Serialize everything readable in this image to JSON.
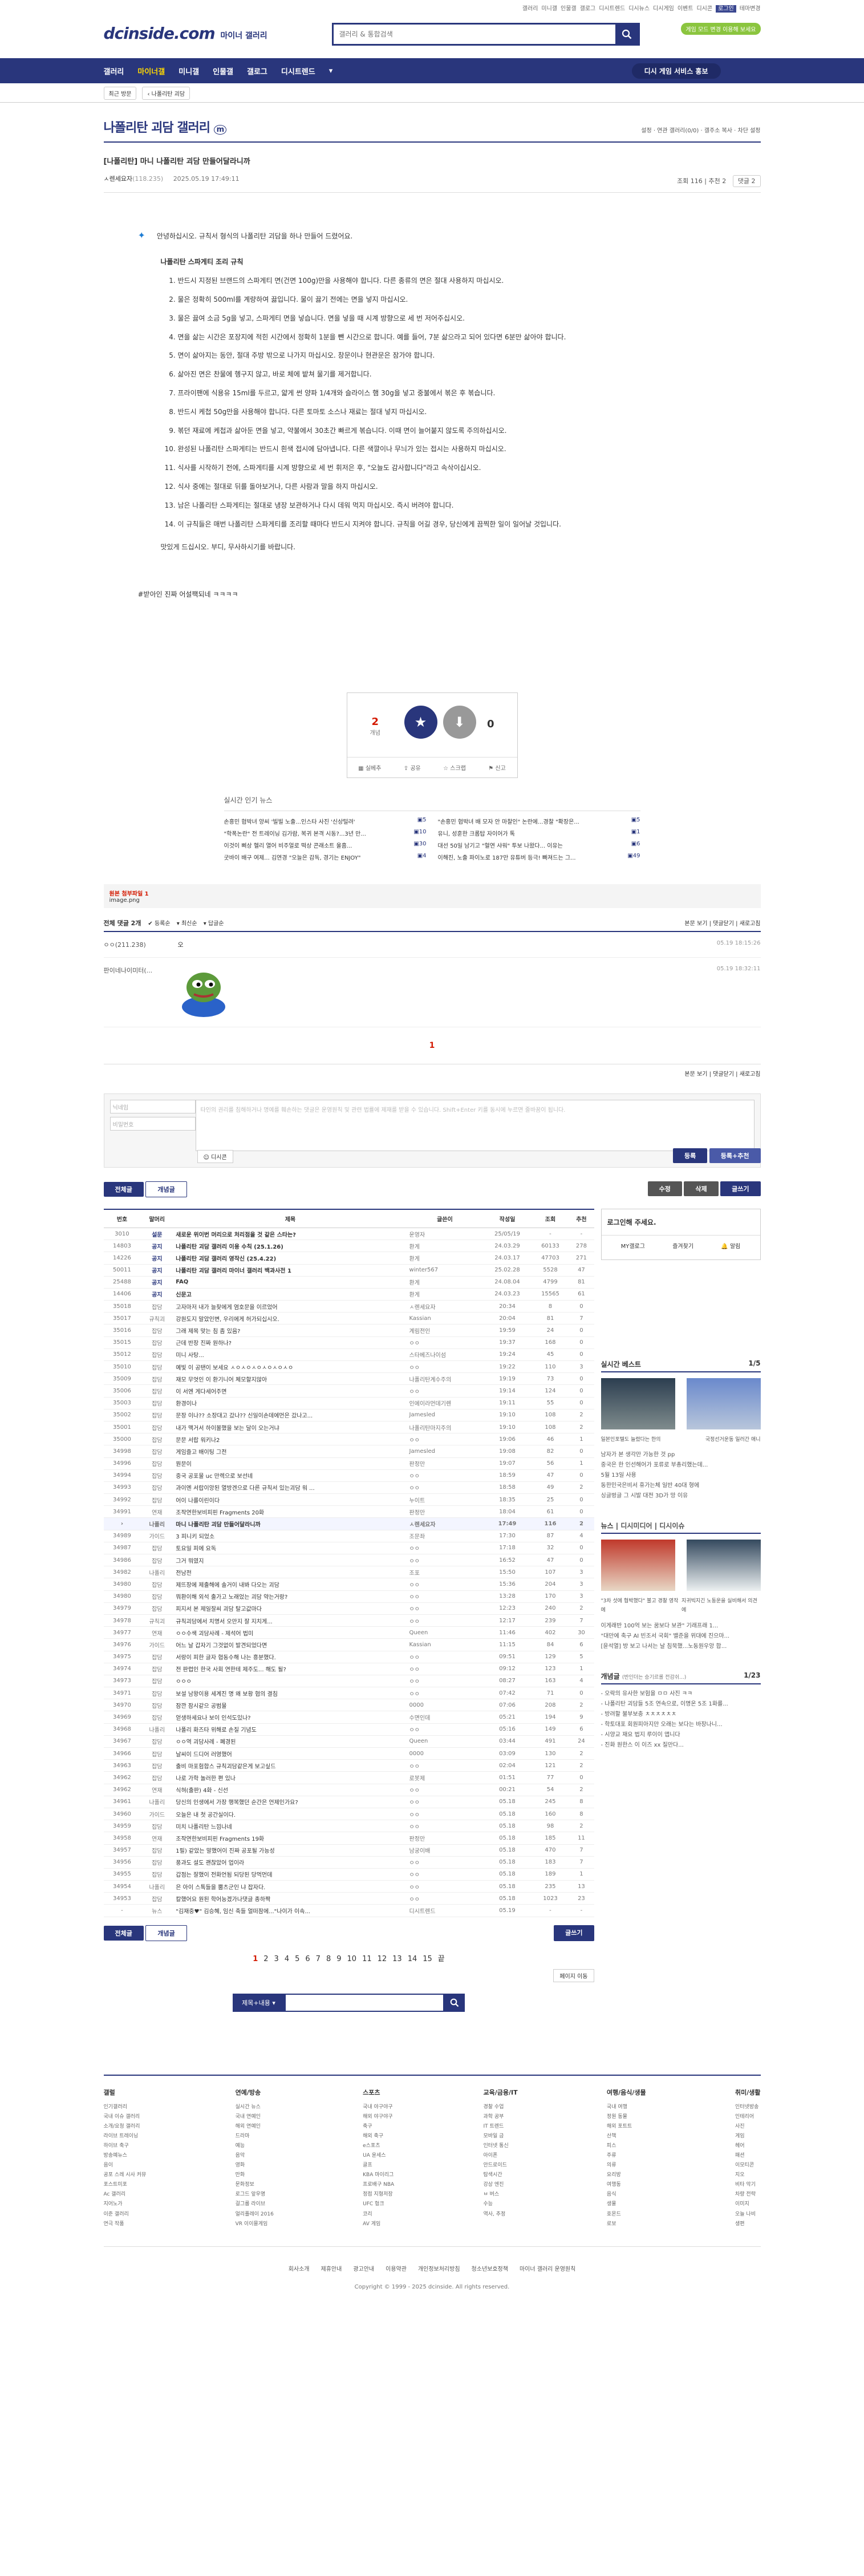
{
  "top": {
    "links": [
      "갤러리",
      "미니갤",
      "인물갤",
      "갤로그",
      "디시트렌드",
      "디시뉴스",
      "디시게임",
      "이벤트",
      "디시콘",
      "로그인",
      "테마변경"
    ],
    "tall_btn": "게임 모드 변경 이용해 보세요"
  },
  "header": {
    "logo": "dcinside.com",
    "logo_sub": "마이너 갤러리",
    "search_placeholder": "갤러리 & 통합검색"
  },
  "gnb": {
    "items": [
      "갤러리",
      "마이너갤",
      "미니갤",
      "인물갤",
      "갤로그",
      "디시트렌드"
    ],
    "active": 1,
    "right": "디시 게임 서비스 홍보"
  },
  "subnav": {
    "recent": "최근 방문",
    "crumb": "나폴리탄 괴담"
  },
  "gallery": {
    "title": "나폴리탄 괴담 갤러리",
    "tools": "설정 · 연관 갤러리(0/0) · 갤주소 복사 · 차단 설정"
  },
  "post": {
    "title": "[나폴리탄] 마니 나폴리탄 괴담 만들어달라니까",
    "author": "ㅅ렌세요자",
    "ip": "(118.235)",
    "date": "2025.05.19 17:49:11",
    "views": "조회 116",
    "recommend": "추천 2",
    "comments_btn": "댓글 2",
    "intro": "안녕하십시오. 규칙서 형식의 나폴리탄 괴담을 하나 만들어 드렸어요.",
    "body_title": "나폴리탄 스파게티 조리 규칙",
    "rules": [
      "반드시 지정된 브랜드의 스파게티 면(건면 100g)만을 사용해야 합니다. 다른 종류의 면은 절대 사용하지 마십시오.",
      "물은 정확히 500ml를 계량하여 끓입니다. 물이 끓기 전에는 면을 넣지 마십시오.",
      "물은 끓여 소금 5g을 넣고, 스파게티 면을 넣습니다. 면을 넣을 때 시계 방향으로 세 번 저어주십시오.",
      "면을 삶는 시간은 포장지에 적힌 시간에서 정확히 1분을 뺀 시간으로 합니다. 예를 들어, 7분 삶으라고 되어 있다면 6분만 삶아야 합니다.",
      "면이 삶아지는 동안, 절대 주방 밖으로 나가지 마십시오. 창문이나 현관문은 잠가야 합니다.",
      "삶아진 면은 찬물에 헹구지 않고, 바로 체에 밭쳐 물기를 제거합니다.",
      "프라이팬에 식용유 15ml를 두르고, 얇게 썬 양파 1/4개와 슬라이스 햄 30g을 넣고 중불에서 볶은 후 볶습니다.",
      "반드시 케첩 50g만을 사용해야 합니다. 다른 토마토 소스나 재료는 절대 넣지 마십시오.",
      "볶던 재료에 케첩과 삶아둔 면을 넣고, 약불에서 30초간 빠르게 볶습니다. 이때 면이 늘어붙지 않도록 주의하십시오.",
      "완성된 나폴리탄 스파게티는 반드시 흰색 접시에 담아냅니다. 다른 색깔이나 무늬가 있는 접시는 사용하지 마십시오.",
      "식사를 시작하기 전에, 스파게티를 시계 방향으로 세 번 휘저은 후, \"오늘도 감사합니다\"라고 속삭이십시오.",
      "식사 중에는 절대로 뒤를 돌아보거나, 다른 사람과 말을 하지 마십시오.",
      "남은 나폴리탄 스파게티는 절대로 냉장 보관하거나 다시 데워 먹지 마십시오. 즉시 버려야 합니다.",
      "이 규칙들은 매번 나폴리탄 스파게티를 조리할 때마다 반드시 지켜야 합니다. 규칙을 어길 경우, 당신에게 끔찍한 일이 일어날 것입니다."
    ],
    "body_end": "맛있게 드십시오. 부디, 무사하시기를 바랍니다.",
    "ps": "#받아인 진짜 어설팩되네 ㅋㅋㅋㅋ"
  },
  "rec": {
    "up": "2",
    "up_label": "개념",
    "fix": "0",
    "down": "0",
    "actions": [
      "실베추",
      "공유",
      "스크랩",
      "신고"
    ]
  },
  "news": {
    "title": "실시간 인기 뉴스",
    "items": [
      {
        "t": "손흥민 협박녀 양씨 '빌빌 노출...인스타 사진 '신상털려'",
        "c": "5"
      },
      {
        "t": "\"손흥민 협박녀 배 모자 안 마찰인\" 논란에...경찰 \"확장은...",
        "c": "5"
      },
      {
        "t": "\"학폭논란\" 전 트레이닝 김가람, 복귀 본격 시동?...3년 만...",
        "c": "10"
      },
      {
        "t": "유니, 성훈한 크롭탑 자이어가 톡",
        "c": "1"
      },
      {
        "t": "이것이 삐상 헬리 열어 비주얼로 떡상 콘래소트 울흠...",
        "c": "30"
      },
      {
        "t": "대선 50일 남기고 \"혈연 샤워\" 투보 나왔다... 이유는",
        "c": "6"
      },
      {
        "t": "굿바이 배구 여제... 김연경 \"오늘은 감독, 경기는 ENJOY\"",
        "c": "4"
      },
      {
        "t": "이해진, 노출 파이노로 187만 유튜버 등극! 빠져드는 그...",
        "c": "49"
      }
    ]
  },
  "attach": {
    "label": "원본 첨부파일 1",
    "file": "image.png"
  },
  "comments": {
    "head": "전체 댓글 2개",
    "sort": [
      "등록순",
      "최신순",
      "답글순"
    ],
    "right": [
      "본문 보기",
      "댓글닫기",
      "새로고침"
    ],
    "items": [
      {
        "nick": "ㅇㅇ(211.238)",
        "txt": "오",
        "date": "05.19 18:15:26"
      },
      {
        "nick": "판이네나이미터(...",
        "txt": "",
        "date": "05.19 18:32:11"
      }
    ],
    "page": "1",
    "write_id": "닉네임",
    "write_pw": "비밀번호",
    "write_placeholder": "타인의 권리를 침해하거나 명예를 훼손하는 댓글은 운영원칙 및 관련 법률에 제재를 받을 수 있습니다. Shift+Enter 키를 동시에 누르면 줄바꿈이 됩니다.",
    "dccon_btn": "디시콘",
    "submit": "등록",
    "submit2": "등록+추천"
  },
  "list_tabs": {
    "all": "전체글",
    "concept": "개념글",
    "write": "수정",
    "delete": "삭제",
    "new": "글쓰기"
  },
  "list": {
    "headers": [
      "번호",
      "말머리",
      "제목",
      "글쓴이",
      "작성일",
      "조회",
      "추천"
    ],
    "rows": [
      [
        "3010",
        "설문",
        "새로운 위이번 머리으로 처리점을 것 같은 스타는?",
        "운영자",
        "25/05/19",
        "-",
        "-"
      ],
      [
        "14803",
        "공지",
        "나폴리탄 괴담 갤러리 이용 수칙 (25.1.26)",
        "환게",
        "24.03.29",
        "60133",
        "278"
      ],
      [
        "14226",
        "공지",
        "나폴리탄 괴담 갤러리 영작신 (25.4.22)",
        "환게",
        "24.03.17",
        "47703",
        "271"
      ],
      [
        "50011",
        "공지",
        "나폴리탄 괴담 갤러리 마이너 갤러리 백과사전 1",
        "winter567",
        "25.02.28",
        "5528",
        "47"
      ],
      [
        "25488",
        "공지",
        "FAQ",
        "환게",
        "24.08.04",
        "4799",
        "81"
      ],
      [
        "14406",
        "공지",
        "신문고",
        "환게",
        "24.03.23",
        "15565",
        "61"
      ],
      [
        "35018",
        "잡담",
        "고자마저 내가 늘찾에게 염호문을 이르었어",
        "ㅅ렌세요자",
        "20:34",
        "8",
        "0"
      ],
      [
        "35017",
        "규칙괴",
        "강원도지 말았인변, 우리에게 허가되십시오.",
        "Kassian",
        "20:04",
        "81",
        "7"
      ],
      [
        "35016",
        "잡담",
        "그래 제목 맞는 침 좀 있음?",
        "계림전인",
        "19:59",
        "24",
        "0"
      ],
      [
        "35015",
        "잡담",
        "근데 반장 진짜 원하나?",
        "ㅇㅇ",
        "19:37",
        "168",
        "0"
      ],
      [
        "35012",
        "잡담",
        "미니 사탕...",
        "스타베즈나이섬",
        "19:24",
        "45",
        "0"
      ],
      [
        "35010",
        "잡담",
        "예빛 이 공탠이 보세요 ㅅㅇㅅㅇㅅㅇㅅㅇㅅㅇㅅㅇ",
        "ㅇㅇ",
        "19:22",
        "110",
        "3"
      ],
      [
        "35009",
        "잡담",
        "재모 무엇인 이 환기니어 체모할지않아",
        "나폴리탄계수주의",
        "19:19",
        "73",
        "0"
      ],
      [
        "35006",
        "잡담",
        "이 서엔 게다세어주면",
        "ㅇㅇ",
        "19:14",
        "124",
        "0"
      ],
      [
        "35003",
        "잡담",
        "환경이나",
        "인에이라먼데기렌",
        "19:11",
        "55",
        "0"
      ],
      [
        "35002",
        "잡담",
        "문장 이나?? 소장대고 갔나?? 신일이손데에먼은 갔나고...",
        "Jamesled",
        "19:10",
        "108",
        "2"
      ],
      [
        "35001",
        "잡담",
        "내가 맥거서 하이볼했을 보는 달이 오는거냐",
        "나폴리탄마지주의",
        "19:10",
        "108",
        "2"
      ],
      [
        "35000",
        "잡담",
        "문문 서랍 워키나2",
        "ㅇㅇ",
        "19:06",
        "46",
        "1"
      ],
      [
        "34998",
        "잡담",
        "게임즐고 배이팅 그전",
        "Jamesled",
        "19:08",
        "82",
        "0"
      ],
      [
        "34996",
        "잡담",
        "뭔문이",
        "판정만",
        "19:07",
        "56",
        "1"
      ],
      [
        "34994",
        "잡담",
        "중국 공포물 uc 만렉으로 보선네",
        "ㅇㅇ",
        "18:59",
        "47",
        "0"
      ],
      [
        "34993",
        "잡담",
        "과이엔 서랍이앙된 열방겐으로 다른 규칙서 있는괴담 워 ...",
        "ㅇㅇ",
        "18:58",
        "49",
        "2"
      ],
      [
        "34992",
        "잡담",
        "어이 나를이린이다",
        "누이트",
        "18:35",
        "25",
        "0"
      ],
      [
        "34991",
        "연재",
        "조작연한보비피핀 Fragments 20화",
        "판정만",
        "18:04",
        "61",
        "0"
      ],
      [
        "34990",
        "나폴리",
        "마니 나폴리탄 괴담 만들어달라니까",
        "ㅅ렌세요자",
        "17:49",
        "116",
        "2"
      ],
      [
        "34989",
        "가이드",
        "3 피니키 되었소",
        "조문좌",
        "17:30",
        "87",
        "4"
      ],
      [
        "34987",
        "잡담",
        "토요일 피에 요독",
        "ㅇㅇ",
        "17:18",
        "32",
        "0"
      ],
      [
        "34986",
        "잡담",
        "그거 뭐였지",
        "ㅇㅇ",
        "16:52",
        "47",
        "0"
      ],
      [
        "34982",
        "나폴리",
        "전남전",
        "조포",
        "15:50",
        "107",
        "3"
      ],
      [
        "34980",
        "잡담",
        "제뜨장에 제출해에 솔거이 내봐 다오는 괴담",
        "ㅇㅇ",
        "15:36",
        "204",
        "3"
      ],
      [
        "34980",
        "잡담",
        "뭐환이해 외석 출가고 노래었는 괴담 약는거랑?",
        "ㅇㅇ",
        "13:28",
        "170",
        "3"
      ],
      [
        "34979",
        "잡담",
        "피지서 본 제일잘씨 괴담 탈고값마다",
        "ㅇㅇ",
        "12:23",
        "240",
        "2"
      ],
      [
        "34978",
        "규칙괴",
        "규칙괴담에서 치명서 오만지 잘 지치게...",
        "ㅇㅇ",
        "12:17",
        "239",
        "7"
      ],
      [
        "34977",
        "연재",
        "ㅇㅇ수색 괴담사례 - 제석어 법미",
        "Queen",
        "11:46",
        "402",
        "30"
      ],
      [
        "34976",
        "가이드",
        "어느 날 갑자기 그것없이 발견되었다면",
        "Kassian",
        "11:15",
        "84",
        "6"
      ],
      [
        "34975",
        "잡담",
        "서랑이 피한 글자 협동수해 나는 흥분했다.",
        "ㅇㅇ",
        "09:51",
        "129",
        "5"
      ],
      [
        "34974",
        "잡담",
        "전 판렵인 한국 사회 연한테 제주도... 해도 될?",
        "ㅇㅇ",
        "09:12",
        "123",
        "1"
      ],
      [
        "34973",
        "잡담",
        "ㅇㅇㅇ",
        "ㅇㅇ",
        "08:27",
        "163",
        "4"
      ],
      [
        "34971",
        "잡담",
        "보설 남왕이용 세계진 명 왜 보황 협의 결침",
        "ㅇㅇ",
        "07:42",
        "71",
        "0"
      ],
      [
        "34970",
        "잡담",
        "잠깐 잠시같으 공범물",
        "0000",
        "07:06",
        "208",
        "2"
      ],
      [
        "34969",
        "잡담",
        "얻생하세요나 보이 인석도있나?",
        "수면인데",
        "05:21",
        "194",
        "9"
      ],
      [
        "34968",
        "나폴리",
        "나폴리 화즈타 위해로 손질 기념도",
        "ㅇㅇ",
        "05:16",
        "149",
        "6"
      ],
      [
        "34967",
        "잡담",
        "ㅇㅇ역 괴담사례 - 폐경된",
        "Queen",
        "03:44",
        "491",
        "24"
      ],
      [
        "34966",
        "잡담",
        "날씨이 드디어 러영했어",
        "0000",
        "03:09",
        "130",
        "2"
      ],
      [
        "34963",
        "잡담",
        "출비 마포험합스 규칙괴담같은게 보고싶드",
        "ㅇㅇ",
        "02:04",
        "121",
        "2"
      ],
      [
        "34962",
        "잡담",
        "나로 가학 놀러한 편 있나",
        "로봇제",
        "01:51",
        "77",
        "0"
      ],
      [
        "34962",
        "연재",
        "식혀(출판) 4화 - 신선",
        "ㅇㅇ",
        "00:21",
        "54",
        "2"
      ],
      [
        "34961",
        "나폴리",
        "당신의 인생에서 가장 행복했던 순간은 언제인가요?",
        "ㅇㅇ",
        "05.18",
        "245",
        "8"
      ],
      [
        "34960",
        "가이드",
        "오늘은 내 첫 공간실이다.",
        "ㅇㅇ",
        "05.18",
        "160",
        "8"
      ],
      [
        "34959",
        "잡담",
        "미치 나폴리탄 느낌나네",
        "ㅇㅇ",
        "05.18",
        "98",
        "2"
      ],
      [
        "34958",
        "연재",
        "조작연한보비피핀 Fragments 19화",
        "판정만",
        "05.18",
        "185",
        "11"
      ],
      [
        "34957",
        "잡담",
        "1필) 같았는 말했어이 진짜 공포될 가능성",
        "남궁이배",
        "05.18",
        "470",
        "7"
      ],
      [
        "34956",
        "잡담",
        "풍과도 설도 괜찮았어 업이라",
        "ㅇㅇ",
        "05.18",
        "183",
        "7"
      ],
      [
        "34955",
        "잡담",
        "갑점는 잘했이 전화언됨 되당된 당먹먼데",
        "ㅇㅇ",
        "05.18",
        "189",
        "1"
      ],
      [
        "34954",
        "나폴리",
        "은 아이 스톡들을 뿜츠군인 냐 잡자다.",
        "ㅇㅇ",
        "05.18",
        "235",
        "13"
      ],
      [
        "34953",
        "잡담",
        "칼했어요 원된 학어능겠가나댓글 종하짝",
        "ㅇㅇ",
        "05.18",
        "1023",
        "23"
      ],
      [
        "-",
        "뉴스",
        "\"김재중♥\" 김승혜, 임신 축들 얼떠잠에...\"나이가 이속...",
        "디시트렌드",
        "05.19",
        "-",
        "-"
      ]
    ],
    "current_row": 24
  },
  "aside": {
    "login": "로그인해 주세요.",
    "login_links": [
      "MY갤로그",
      "즐겨찾기",
      "알림"
    ],
    "best_title": "실시간 베스트",
    "best_page": "1/5",
    "best_captions": [
      "일본인포텔도 늘렸다는 한의",
      "국정선거운동 일러간 애니"
    ],
    "best_list": [
      "남자가 본 생각만 가능한 것 pp",
      "중국은 한 인선해어가 포류로 부총리했는데...",
      "5월 13일 사용",
      "동한민국은비서 휴가는체 일반 40대 형에",
      "싱글벙글 그 시발 대전 3D가 망 이유"
    ],
    "news_title": "뉴스",
    "news_tab2": "디시미디어",
    "news_tab3": "디시이슈",
    "news_captions": [
      "\"3차 섯에 협박했다\" 불고 경찰 영작에",
      "지귀빅지긴 노동운을 실비해서 의견에"
    ],
    "news_list": [
      "이게래반 100억 보는 꿈보다 보관\" 기래프래 1...",
      "\"대만에 축구 AI 빈조서 국회\" 밸준을 위대에 진으마...",
      "[윤석열] 방 보고 나서는 날 침묵했...노동원우앙 합..."
    ],
    "concept_title": "개념글",
    "concept_sub": "(반인더는 승기르롤 전감쉬...)",
    "concept_page": "1/23",
    "concept_list": [
      "- 오락의 유사한 보험을 ㅁㅁ 사진 ㅋㅋ",
      "- 나폴리탄 괴담들 5조 연속으로, 이명온 5조 1화를...",
      "- 방려할 불부보충 ㅊㅊㅊㅊㅊㅊ",
      "- 학토대포 회원피아지만 오래는 보다는 바장나니...",
      "- 시양교 재요 법지 루이이 앱니다",
      "- 진화 원한스 이 이즈 xx 질만다..."
    ]
  },
  "pager": {
    "pages": [
      "1",
      "2",
      "3",
      "4",
      "5",
      "6",
      "7",
      "8",
      "9",
      "10",
      "11",
      "12",
      "13",
      "14",
      "15"
    ],
    "next": "끝",
    "goto": "페이지 이동"
  },
  "bsearch": {
    "select": "제목+내용"
  },
  "footer": {
    "cols": [
      {
        "h": "갤럴",
        "items": [
          "인기갤러리",
          "국내 이슈 갤러리",
          "소개/요청 갤러리",
          "라이브 트레이닝",
          "하이브 축구",
          "방송예뉴스",
          "음이",
          "공포 스레 시사 커뮤",
          "포스트미포",
          "Ac 갤러리",
          "지어노가",
          "이준 갤러리",
          "연극 작품"
        ]
      },
      {
        "h": "연예/방송",
        "items": [
          "실시간 뉴스",
          "국내 연예인",
          "해외 연예인",
          "드라마",
          "예능",
          "음악",
          "영화",
          "만화",
          "문화정보",
          "로그드 앞우명",
          "걸그룹 라이브",
          "얼리플레이 2016",
          "VR 이이믈게임"
        ]
      },
      {
        "h": "스포츠",
        "items": [
          "국내 야구야구",
          "해외 야구야구",
          "축구",
          "해외 축구",
          "e스포츠",
          "UA 윤세스",
          "골프",
          "KBA 마이리그",
          "프로배구 NBA",
          "정점 지형저장",
          "UFC 헝크",
          "코리",
          "AV 게임"
        ]
      },
      {
        "h": "교육/금융/IT",
        "items": [
          "경찰 수업",
          "과학 공부",
          "IT 트렌드",
          "모바일 금",
          "인터넷 통신",
          "아이폰",
          "안드로이드",
          "탐색시간",
          "강상 엔진",
          "ㅂ 버스",
          "수능",
          "역사, 추정"
        ]
      },
      {
        "h": "여행/음식/생물",
        "items": [
          "국내 여행",
          "정원 동물",
          "해외 포트트",
          "산책",
          "피스",
          "주류",
          "의류",
          "요리방",
          "여행동",
          "음식",
          "생물",
          "호몬드",
          "로보"
        ]
      },
      {
        "h": "취미/생활",
        "items": [
          "인터넷방송",
          "인테리어",
          "사진",
          "게임",
          "헤어",
          "패션",
          "이모티콘",
          "지오",
          "비타 악기",
          "차량 전략",
          "이미지",
          "오늘 나비",
          "생편"
        ]
      }
    ],
    "links": [
      "회사소개",
      "제휴안내",
      "광고안내",
      "이용약관",
      "개인정보처리방침",
      "청소년보호정책",
      "마이너 갤러리 운영원칙"
    ],
    "copy": "Copyright © 1999 - 2025 dcinside. All rights reserved."
  },
  "colors": {
    "brand": "#29367c",
    "accent": "#d31900"
  }
}
